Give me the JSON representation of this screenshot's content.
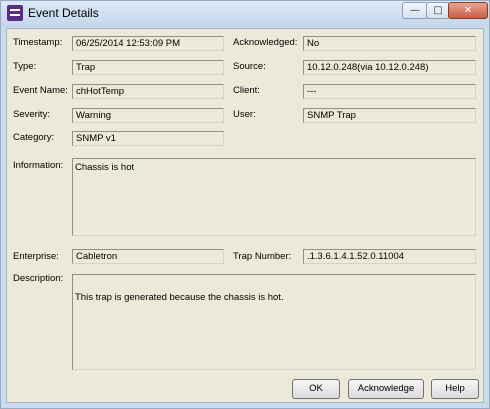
{
  "window": {
    "title": "Event Details",
    "minimize_glyph": "—",
    "maximize_glyph": "□",
    "close_glyph": "✕",
    "app_icon": "event-details-app-icon"
  },
  "fields": {
    "timestamp": {
      "label": "Timestamp:",
      "value": "06/25/2014 12:53:09 PM"
    },
    "acknowledged": {
      "label": "Acknowledged:",
      "value": "No"
    },
    "type": {
      "label": "Type:",
      "value": "Trap"
    },
    "source": {
      "label": "Source:",
      "value": "10.12.0.248(via 10.12.0.248)"
    },
    "event_name": {
      "label": "Event Name:",
      "value": "chHotTemp"
    },
    "client": {
      "label": "Client:",
      "value": "---"
    },
    "severity": {
      "label": "Severity:",
      "value": "Warning"
    },
    "user": {
      "label": "User:",
      "value": "SNMP Trap"
    },
    "category": {
      "label": "Category:",
      "value": "SNMP v1"
    },
    "information": {
      "label": "Information:",
      "value": "Chassis is hot"
    },
    "enterprise": {
      "label": "Enterprise:",
      "value": "Cabletron"
    },
    "trap_number": {
      "label": "Trap Number:",
      "value": ".1.3.6.1.4.1.52.0.11004"
    },
    "description": {
      "label": "Description:",
      "value": "This trap is generated because the chassis is hot."
    }
  },
  "buttons": {
    "ok": "OK",
    "acknowledge": "Acknowledge",
    "help": "Help"
  }
}
